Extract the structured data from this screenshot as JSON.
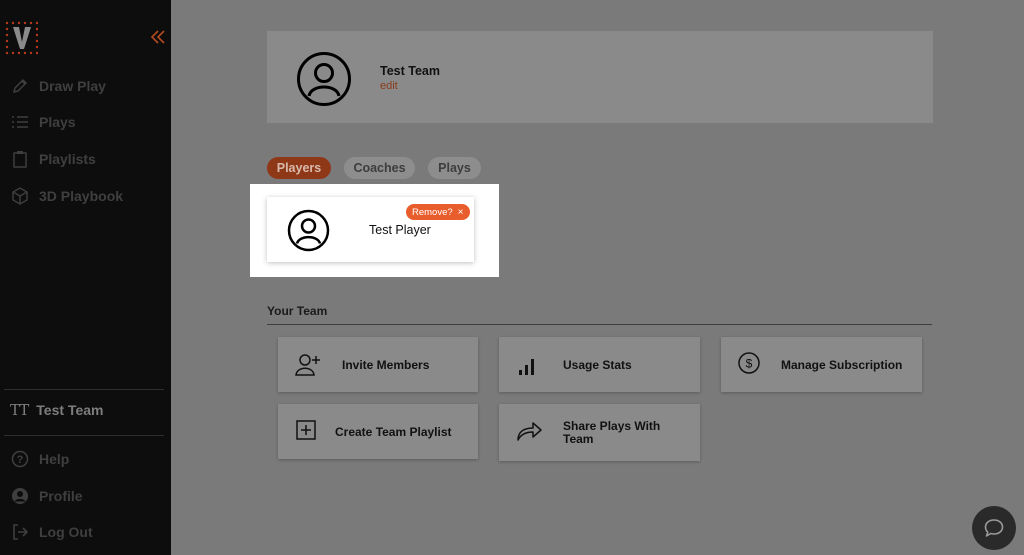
{
  "sidebar": {
    "logo": "V",
    "collapse_icon": "double-chevron-left-icon",
    "nav": [
      {
        "label": "Draw Play",
        "icon": "pencil-icon"
      },
      {
        "label": "Plays",
        "icon": "list-icon"
      },
      {
        "label": "Playlists",
        "icon": "clipboard-icon"
      },
      {
        "label": "3D Playbook",
        "icon": "cube-icon"
      }
    ],
    "team": {
      "initials": "TT",
      "label": "Test Team"
    },
    "bottom": [
      {
        "label": "Help",
        "icon": "help-icon"
      },
      {
        "label": "Profile",
        "icon": "user-icon"
      },
      {
        "label": "Log Out",
        "icon": "logout-icon"
      }
    ]
  },
  "header": {
    "team_name": "Test Team",
    "edit_label": "edit"
  },
  "tabs": [
    {
      "label": "Players",
      "active": true
    },
    {
      "label": "Coaches",
      "active": false
    },
    {
      "label": "Plays",
      "active": false
    }
  ],
  "player_card": {
    "name": "Test Player",
    "remove_label": "Remove?",
    "remove_x": "×"
  },
  "your_team": {
    "title": "Your Team",
    "tiles": [
      {
        "label": "Invite Members",
        "icon": "add-user-icon"
      },
      {
        "label": "Usage Stats",
        "icon": "bar-chart-icon"
      },
      {
        "label": "Manage Subscription",
        "icon": "dollar-icon"
      },
      {
        "label": "Create Team Playlist",
        "icon": "plus-square-icon"
      },
      {
        "label": "Share Plays With Team",
        "icon": "share-icon"
      }
    ]
  },
  "colors": {
    "accent": "#e85d2b",
    "sidebar_bg": "#0d0d0d",
    "overlay": "#7a7a7a"
  }
}
